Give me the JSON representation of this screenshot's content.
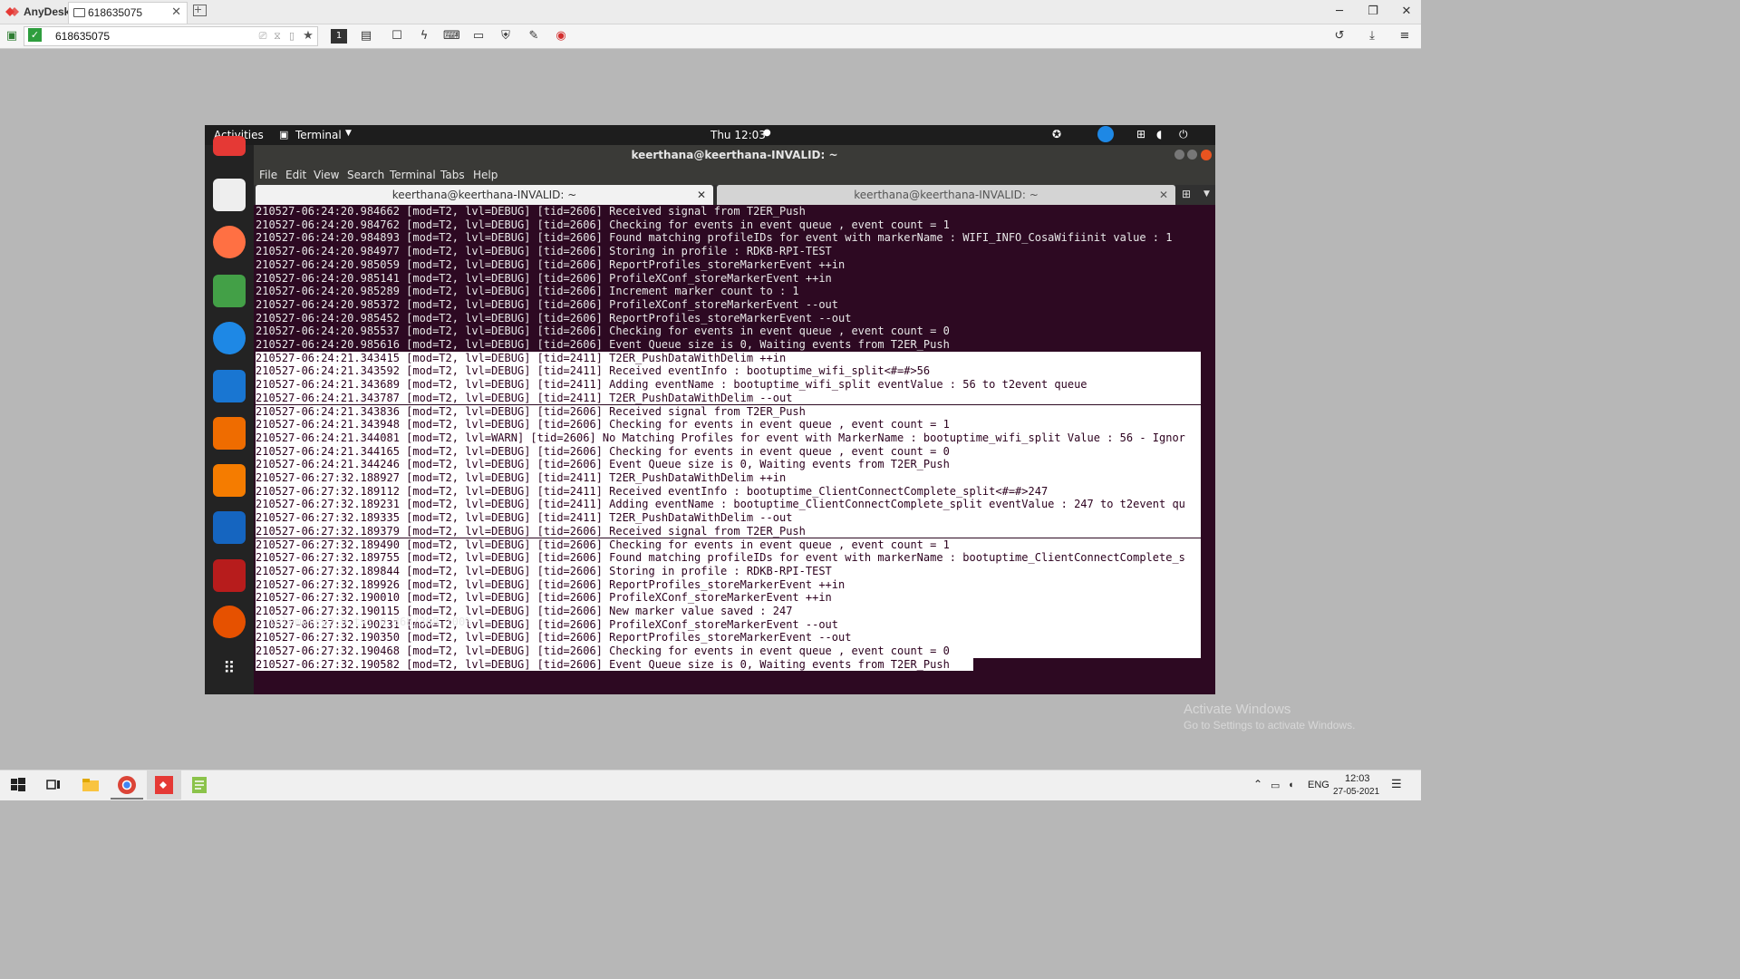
{
  "anydesk": {
    "brand": "AnyDesk",
    "tab_label": "618635075",
    "address_value": "618635075",
    "toolbar_active_monitor": "1"
  },
  "ubuntu": {
    "activities": "Activities",
    "app_menu": "Terminal",
    "clock": "Thu 12:03"
  },
  "terminal": {
    "window_title": "keerthana@keerthana-INVALID: ~",
    "menu": [
      "File",
      "Edit",
      "View",
      "Search",
      "Terminal",
      "Tabs",
      "Help"
    ],
    "tabs": [
      {
        "label": "keerthana@keerthana-INVALID: ~"
      },
      {
        "label": "keerthana@keerthana-INVALID: ~"
      }
    ],
    "lines": [
      "210527-06:24:20.984662 [mod=T2, lvl=DEBUG] [tid=2606] Received signal from T2ER_Push",
      "210527-06:24:20.984762 [mod=T2, lvl=DEBUG] [tid=2606] Checking for events in event queue , event count = 1",
      "210527-06:24:20.984893 [mod=T2, lvl=DEBUG] [tid=2606] Found matching profileIDs for event with markerName : WIFI_INFO_CosaWifiinit value : 1",
      "210527-06:24:20.984977 [mod=T2, lvl=DEBUG] [tid=2606] Storing in profile : RDKB-RPI-TEST",
      "210527-06:24:20.985059 [mod=T2, lvl=DEBUG] [tid=2606] ReportProfiles_storeMarkerEvent ++in",
      "210527-06:24:20.985141 [mod=T2, lvl=DEBUG] [tid=2606] ProfileXConf_storeMarkerEvent ++in",
      "210527-06:24:20.985289 [mod=T2, lvl=DEBUG] [tid=2606] Increment marker count to : 1",
      "210527-06:24:20.985372 [mod=T2, lvl=DEBUG] [tid=2606] ProfileXConf_storeMarkerEvent --out",
      "210527-06:24:20.985452 [mod=T2, lvl=DEBUG] [tid=2606] ReportProfiles_storeMarkerEvent --out",
      "210527-06:24:20.985537 [mod=T2, lvl=DEBUG] [tid=2606] Checking for events in event queue , event count = 0",
      "210527-06:24:20.985616 [mod=T2, lvl=DEBUG] [tid=2606] Event Queue size is 0, Waiting events from T2ER_Push",
      "210527-06:24:21.343415 [mod=T2, lvl=DEBUG] [tid=2411] T2ER_PushDataWithDelim ++in",
      "210527-06:24:21.343592 [mod=T2, lvl=DEBUG] [tid=2411] Received eventInfo : bootuptime_wifi_split<#=#>56",
      "210527-06:24:21.343689 [mod=T2, lvl=DEBUG] [tid=2411] Adding eventName : bootuptime_wifi_split eventValue : 56 to t2event queue",
      "210527-06:24:21.343787 [mod=T2, lvl=DEBUG] [tid=2411] T2ER_PushDataWithDelim --out",
      "210527-06:24:21.343836 [mod=T2, lvl=DEBUG] [tid=2606] Received signal from T2ER_Push",
      "210527-06:24:21.343948 [mod=T2, lvl=DEBUG] [tid=2606] Checking for events in event queue , event count = 1",
      "210527-06:24:21.344081 [mod=T2, lvl=WARN] [tid=2606] No Matching Profiles for event with MarkerName : bootuptime_wifi_split Value : 56 - Ignor",
      "210527-06:24:21.344165 [mod=T2, lvl=DEBUG] [tid=2606] Checking for events in event queue , event count = 0",
      "210527-06:24:21.344246 [mod=T2, lvl=DEBUG] [tid=2606] Event Queue size is 0, Waiting events from T2ER_Push",
      "210527-06:27:32.188927 [mod=T2, lvl=DEBUG] [tid=2411] T2ER_PushDataWithDelim ++in",
      "210527-06:27:32.189112 [mod=T2, lvl=DEBUG] [tid=2411] Received eventInfo : bootuptime_ClientConnectComplete_split<#=#>247",
      "210527-06:27:32.189231 [mod=T2, lvl=DEBUG] [tid=2411] Adding eventName : bootuptime_ClientConnectComplete_split eventValue : 247 to t2event qu",
      "210527-06:27:32.189335 [mod=T2, lvl=DEBUG] [tid=2411] T2ER_PushDataWithDelim --out",
      "210527-06:27:32.189379 [mod=T2, lvl=DEBUG] [tid=2606] Received signal from T2ER_Push",
      "210527-06:27:32.189490 [mod=T2, lvl=DEBUG] [tid=2606] Checking for events in event queue , event count = 1",
      "210527-06:27:32.189755 [mod=T2, lvl=DEBUG] [tid=2606] Found matching profileIDs for event with markerName : bootuptime_ClientConnectComplete_s",
      "210527-06:27:32.189844 [mod=T2, lvl=DEBUG] [tid=2606] Storing in profile : RDKB-RPI-TEST",
      "210527-06:27:32.189926 [mod=T2, lvl=DEBUG] [tid=2606] ReportProfiles_storeMarkerEvent ++in",
      "210527-06:27:32.190010 [mod=T2, lvl=DEBUG] [tid=2606] ProfileXConf_storeMarkerEvent ++in",
      "210527-06:27:32.190115 [mod=T2, lvl=DEBUG] [tid=2606] New marker value saved : 247",
      "210527-06:27:32.190231 [mod=T2, lvl=DEBUG] [tid=2606] ProfileXConf_storeMarkerEvent --out",
      "210527-06:27:32.190350 [mod=T2, lvl=DEBUG] [tid=2606] ReportProfiles_storeMarkerEvent --out",
      "210527-06:27:32.190468 [mod=T2, lvl=DEBUG] [tid=2606] Checking for events in event queue , event count = 0",
      "210527-06:27:32.190582 [mod=T2, lvl=DEBUG] [tid=2606] Event Queue size is 0, Waiting events from T2ER_Push"
    ],
    "status_line": "- telemetry2_0.txt.0 368/368 100%"
  },
  "activate": {
    "title": "Activate Windows",
    "subtitle": "Go to Settings to activate Windows."
  },
  "taskbar": {
    "lang": "ENG",
    "time": "12:03",
    "date": "27-05-2021"
  }
}
